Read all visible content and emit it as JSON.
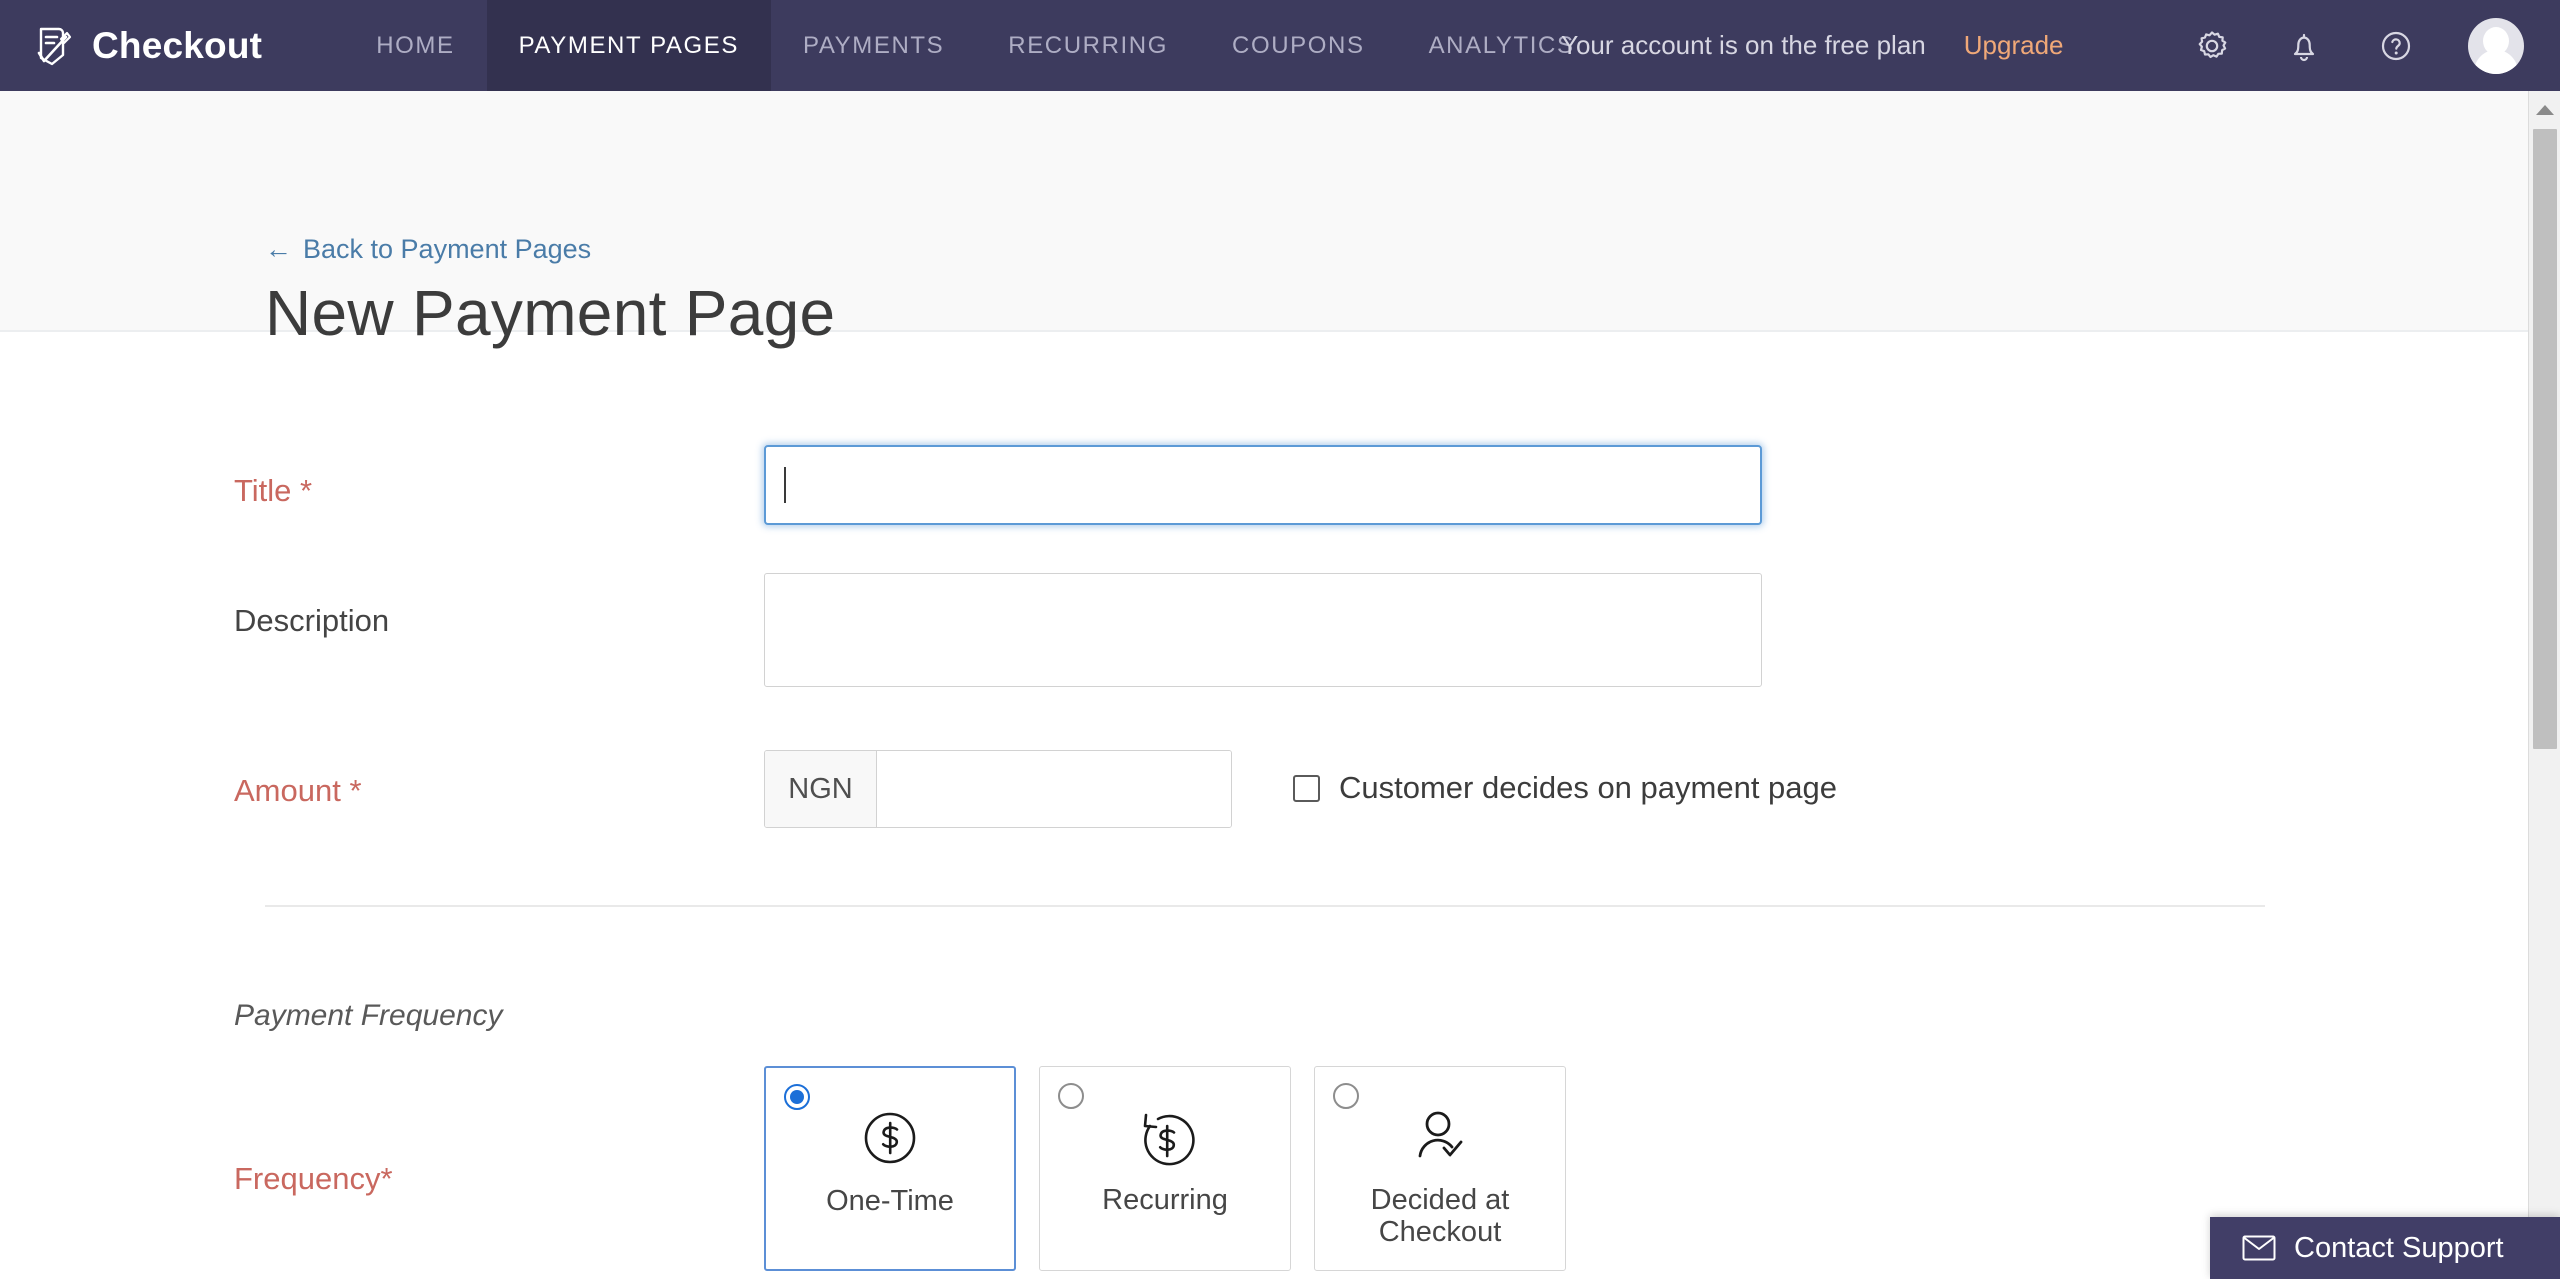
{
  "topnav": {
    "brand": {
      "name": "Checkout",
      "icon": "receipt-pen-icon"
    },
    "links": [
      {
        "label": "HOME",
        "active": false
      },
      {
        "label": "PAYMENT PAGES",
        "active": true
      },
      {
        "label": "PAYMENTS",
        "active": false
      },
      {
        "label": "RECURRING",
        "active": false
      },
      {
        "label": "COUPONS",
        "active": false
      },
      {
        "label": "ANALYTICS",
        "active": false
      }
    ],
    "plan_notice": "Your account is on the free plan",
    "upgrade_label": "Upgrade",
    "icons": [
      "gear-icon",
      "bell-icon",
      "help-icon",
      "avatar"
    ],
    "background": "#3d3b5e",
    "active_tab_background": "#33314f",
    "upgrade_color": "#f0a878"
  },
  "page": {
    "back_link": "Back to Payment Pages",
    "back_arrow": "←",
    "title": "New Payment Page",
    "back_link_color": "#4a7ca8"
  },
  "form": {
    "title": {
      "label": "Title *",
      "required": true,
      "value": "",
      "placeholder": "",
      "focused": true
    },
    "description": {
      "label": "Description",
      "required": false,
      "value": "",
      "placeholder": ""
    },
    "amount": {
      "label": "Amount *",
      "required": true,
      "currency": "NGN",
      "value": "",
      "placeholder": "",
      "customer_decides": {
        "label": "Customer decides on payment page",
        "checked": false
      }
    },
    "payment_frequency": {
      "section_label": "Payment Frequency",
      "field_label": "Frequency*",
      "required": true,
      "selected": "One-Time",
      "options": [
        {
          "label": "One-Time",
          "icon": "dollar-circle-icon",
          "selected": true
        },
        {
          "label": "Recurring",
          "icon": "dollar-recurring-icon",
          "selected": false
        },
        {
          "label": "Decided at\nCheckout",
          "label_line1": "Decided at",
          "label_line2": "Checkout",
          "icon": "person-check-icon",
          "selected": false
        }
      ]
    },
    "required_color": "#c9685f",
    "focus_color": "#5c9ad6"
  },
  "contact_support": {
    "label": "Contact Support",
    "icon": "envelope-icon",
    "background": "#413e67"
  },
  "scrollbar": {
    "up_arrow": "▲",
    "down_arrow": "▼"
  }
}
